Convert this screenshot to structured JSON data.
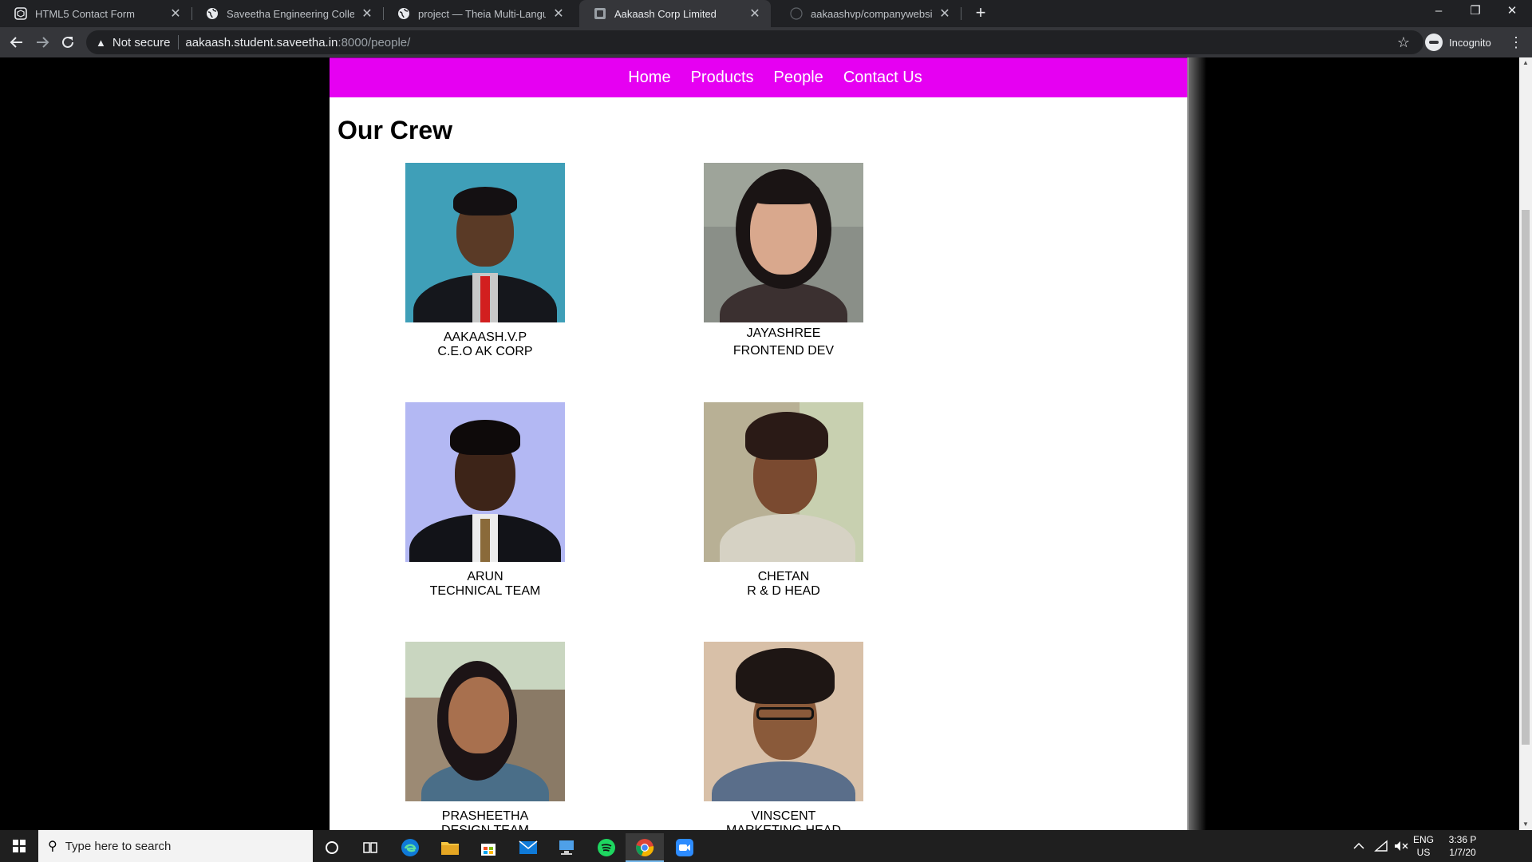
{
  "browser": {
    "tabs": [
      {
        "title": "HTML5 Contact Form",
        "icon": "codepen-icon"
      },
      {
        "title": "Saveetha Engineering College",
        "icon": "globe-icon"
      },
      {
        "title": "project — Theia Multi-Language",
        "icon": "globe-icon"
      },
      {
        "title": "Aakaash Corp Limited",
        "icon": "page-icon",
        "active": true
      },
      {
        "title": "aakaashvp/companywebsite",
        "icon": "github-icon"
      }
    ],
    "security_label": "Not secure",
    "url_host": "aakaash.student.saveetha.in",
    "url_rest": ":8000/people/",
    "profile_label": "Incognito"
  },
  "site": {
    "nav": [
      "Home",
      "Products",
      "People",
      "Contact Us"
    ],
    "nav_color": "#e600f2",
    "page_title": "Our Crew",
    "members": [
      {
        "name": "AAKAASH.V.P",
        "role": "C.E.O AK CORP",
        "photo_bg": "#3f9fb8"
      },
      {
        "name": "JAYASHREE",
        "role": "FRONTEND DEV",
        "photo_bg": "#8a8f88"
      },
      {
        "name": "ARUN",
        "role": "TECHNICAL TEAM",
        "photo_bg": "#b3b8f3"
      },
      {
        "name": "CHETAN",
        "role": "R & D HEAD",
        "photo_bg": "#b8b095"
      },
      {
        "name": "PRASHEETHA",
        "role": "DESIGN TEAM",
        "photo_bg": "#9c8a74"
      },
      {
        "name": "VINSCENT",
        "role": "MARKETING HEAD",
        "photo_bg": "#d8c0a8"
      }
    ]
  },
  "taskbar": {
    "search_placeholder": "Type here to search",
    "lang_top": "ENG",
    "lang_bottom": "US",
    "time": "3:36 P",
    "date": "1/7/20"
  }
}
